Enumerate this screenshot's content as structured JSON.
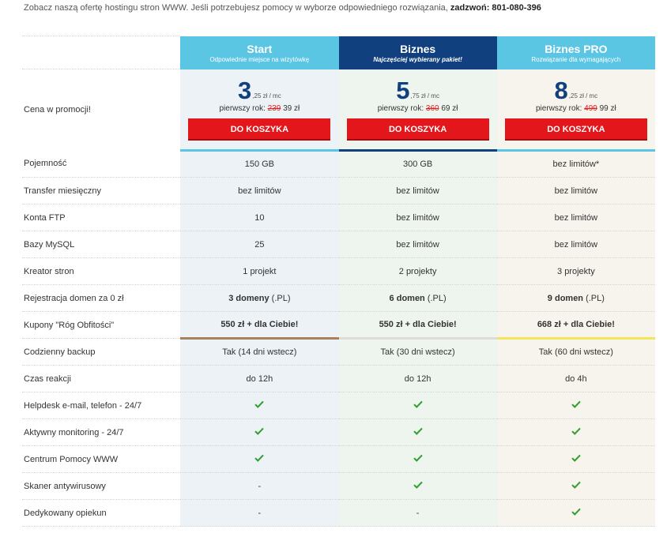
{
  "intro": {
    "text": "Zobacz naszą ofertę hostingu stron WWW. Jeśli potrzebujesz pomocy w wyborze odpowiedniego rozwiązania,",
    "call_label": "zadzwoń: 801-080-396"
  },
  "plans": [
    {
      "name": "Start",
      "subtitle": "Odpowiednie miejsce na wizytówkę",
      "price_big": "3",
      "price_small": ",25 zł / mc",
      "first_year_label": "pierwszy rok:",
      "old_price": "239",
      "new_price": "39 zł",
      "cart_label": "DO KOSZYKA"
    },
    {
      "name": "Biznes",
      "subtitle": "Najczęściej wybierany pakiet!",
      "price_big": "5",
      "price_small": ",75 zł / mc",
      "first_year_label": "pierwszy rok:",
      "old_price": "360",
      "new_price": "69 zł",
      "cart_label": "DO KOSZYKA"
    },
    {
      "name": "Biznes PRO",
      "subtitle": "Rozwiązanie dla wymagających",
      "price_big": "8",
      "price_small": ",25 zł / mc",
      "first_year_label": "pierwszy rok:",
      "old_price": "499",
      "new_price": "99 zł",
      "cart_label": "DO KOSZYKA"
    }
  ],
  "price_label": "Cena w promocji!",
  "features": [
    {
      "label": "Pojemność",
      "values": [
        {
          "text": "150 GB"
        },
        {
          "text": "300 GB"
        },
        {
          "text": "bez limitów*"
        }
      ]
    },
    {
      "label": "Transfer miesięczny",
      "values": [
        {
          "text": "bez limitów"
        },
        {
          "text": "bez limitów"
        },
        {
          "text": "bez limitów"
        }
      ]
    },
    {
      "label": "Konta FTP",
      "values": [
        {
          "text": "10"
        },
        {
          "text": "bez limitów"
        },
        {
          "text": "bez limitów"
        }
      ]
    },
    {
      "label": "Bazy MySQL",
      "values": [
        {
          "text": "25"
        },
        {
          "text": "bez limitów"
        },
        {
          "text": "bez limitów"
        }
      ]
    },
    {
      "label": "Kreator stron",
      "values": [
        {
          "text": "1 projekt"
        },
        {
          "text": "2 projekty"
        },
        {
          "text": "3 projekty"
        }
      ]
    },
    {
      "label": "Rejestracja domen za 0 zł",
      "values": [
        {
          "bold": "3 domeny",
          "text": " (.PL)"
        },
        {
          "bold": "6 domen",
          "text": " (.PL)"
        },
        {
          "bold": "9 domen",
          "text": " (.PL)"
        }
      ]
    },
    {
      "label": "Kupony \"Róg Obfitości\"",
      "values": [
        {
          "bold": "550 zł + dla Ciebie!"
        },
        {
          "bold": "550 zł + dla Ciebie!"
        },
        {
          "bold": "668 zł + dla Ciebie!"
        }
      ]
    },
    {
      "label": "Codzienny backup",
      "values": [
        {
          "text": "Tak (14 dni wstecz)"
        },
        {
          "text": "Tak (30 dni wstecz)"
        },
        {
          "text": "Tak (60 dni wstecz)"
        }
      ]
    },
    {
      "label": "Czas reakcji",
      "values": [
        {
          "text": "do 12h"
        },
        {
          "text": "do 12h"
        },
        {
          "text": "do 4h"
        }
      ]
    },
    {
      "label": "Helpdesk e-mail, telefon - 24/7",
      "values": [
        {
          "icon": "check"
        },
        {
          "icon": "check"
        },
        {
          "icon": "check"
        }
      ]
    },
    {
      "label": "Aktywny monitoring - 24/7",
      "values": [
        {
          "icon": "check"
        },
        {
          "icon": "check"
        },
        {
          "icon": "check"
        }
      ]
    },
    {
      "label": "Centrum Pomocy WWW",
      "values": [
        {
          "icon": "check"
        },
        {
          "icon": "check"
        },
        {
          "icon": "check"
        }
      ]
    },
    {
      "label": "Skaner antywirusowy",
      "values": [
        {
          "text": "-"
        },
        {
          "icon": "check"
        },
        {
          "icon": "check"
        }
      ]
    },
    {
      "label": "Dedykowany opiekun",
      "values": [
        {
          "text": "-"
        },
        {
          "text": "-"
        },
        {
          "icon": "check"
        }
      ]
    }
  ],
  "colors": {
    "header_light": "#5bc5e4",
    "header_dark": "#10407e",
    "cart_button": "#e3161b",
    "check": "#2e9e2e",
    "strike": "#e02020"
  }
}
